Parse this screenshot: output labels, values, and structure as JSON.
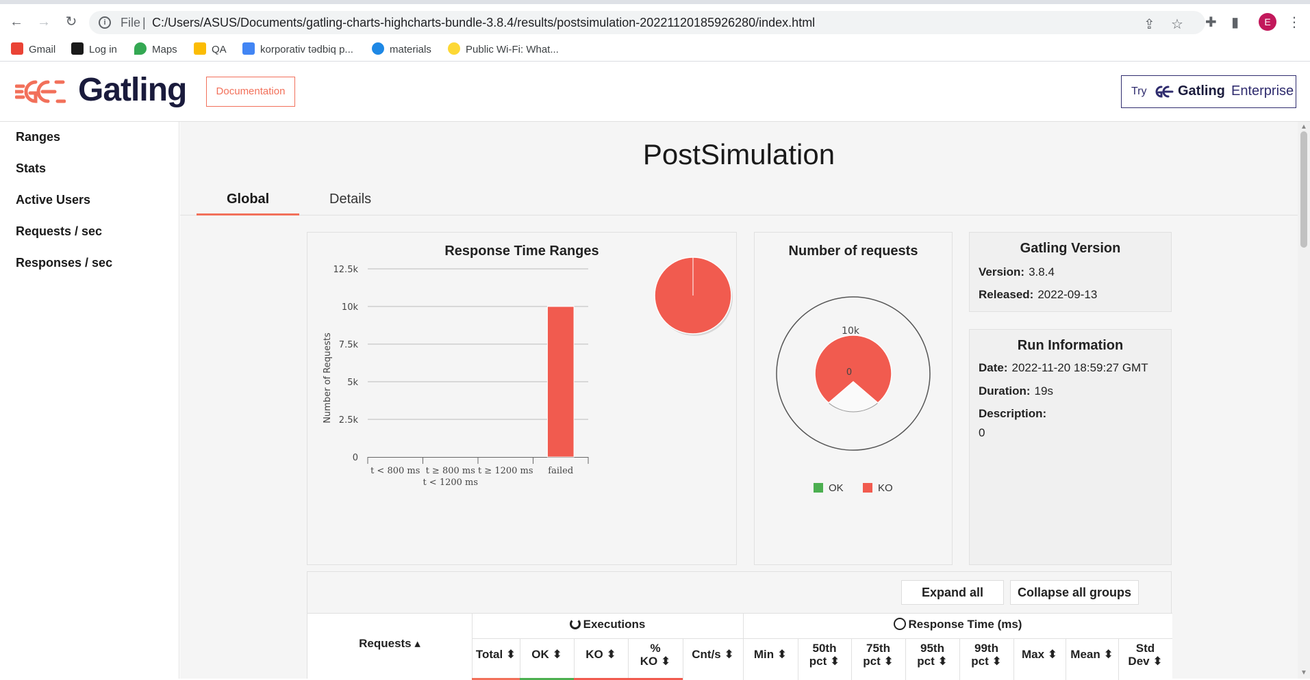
{
  "browser": {
    "scheme": "File",
    "separator": "|",
    "url": "C:/Users/ASUS/Documents/gatling-charts-highcharts-bundle-3.8.4/results/postsimulation-20221120185926280/index.html",
    "profile_initial": "E",
    "bookmarks": [
      {
        "label": "Gmail",
        "color": "#ea4335"
      },
      {
        "label": "Log in",
        "color": "#1a1a1a"
      },
      {
        "label": "Maps",
        "color": "#34a853"
      },
      {
        "label": "QA",
        "color": "#fbbc04"
      },
      {
        "label": "korporativ tədbiq p...",
        "color": "#4285f4"
      },
      {
        "label": "materials",
        "color": "#1e88e5"
      },
      {
        "label": "Public Wi-Fi: What...",
        "color": "#fdd835"
      }
    ]
  },
  "header": {
    "logo_text": "Gatling",
    "documentation_label": "Documentation",
    "enterprise": {
      "try": "Try",
      "gatling": "Gatling",
      "enterprise": "Enterprise"
    }
  },
  "sidebar": {
    "items": [
      "Ranges",
      "Stats",
      "Active Users",
      "Requests / sec",
      "Responses / sec"
    ]
  },
  "page": {
    "title": "PostSimulation",
    "tabs": [
      "Global",
      "Details"
    ],
    "active_tab": "Global"
  },
  "response_time_ranges": {
    "title": "Response Time Ranges",
    "ylabel": "Number of Requests"
  },
  "number_of_requests": {
    "title": "Number of requests",
    "outer_label": "10k",
    "inner_label": "0",
    "legend": [
      {
        "label": "OK",
        "color": "#4caf50"
      },
      {
        "label": "KO",
        "color": "#f15b4f"
      }
    ]
  },
  "gatling_version": {
    "title": "Gatling Version",
    "version_label": "Version:",
    "version": "3.8.4",
    "released_label": "Released:",
    "released": "2022-09-13"
  },
  "run_information": {
    "title": "Run Information",
    "date_label": "Date:",
    "date": "2022-11-20 18:59:27 GMT",
    "duration_label": "Duration:",
    "duration": "19s",
    "description_label": "Description:",
    "description": "0"
  },
  "table": {
    "expand_label": "Expand all groups",
    "collapse_label": "Collapse all groups",
    "requests_header": "Requests ▴",
    "executions_header": "Executions",
    "response_time_header": "Response Time (ms)",
    "columns": [
      "Total ⬍",
      "OK ⬍",
      "KO ⬍",
      "% KO ⬍",
      "Cnt/s ⬍",
      "Min ⬍",
      "50th pct ⬍",
      "75th pct ⬍",
      "95th pct ⬍",
      "99th pct ⬍",
      "Max ⬍",
      "Mean ⬍",
      "Std Dev ⬍"
    ]
  },
  "colors": {
    "accent": "#f2705a",
    "ko": "#f15b4f",
    "ok": "#4caf50",
    "brand_dark": "#1a1b3c",
    "enterprise": "#2f2c6e"
  },
  "chart_data": [
    {
      "type": "bar",
      "title": "Response Time Ranges",
      "ylabel": "Number of Requests",
      "categories": [
        "t < 800 ms",
        "t ≥ 800 ms t < 1200 ms",
        "t ≥ 1200 ms",
        "failed"
      ],
      "values": [
        0,
        0,
        0,
        10000
      ],
      "yticks": [
        "0",
        "2.5k",
        "5k",
        "7.5k",
        "10k",
        "12.5k"
      ],
      "ylim": [
        0,
        12500
      ],
      "grid": true
    },
    {
      "type": "pie",
      "title": "Response Time Ranges (mini)",
      "labels": [
        "failed"
      ],
      "values": [
        100
      ]
    },
    {
      "type": "pie",
      "title": "Number of requests",
      "labels": [
        "OK",
        "KO"
      ],
      "values": [
        0,
        10000
      ]
    }
  ]
}
